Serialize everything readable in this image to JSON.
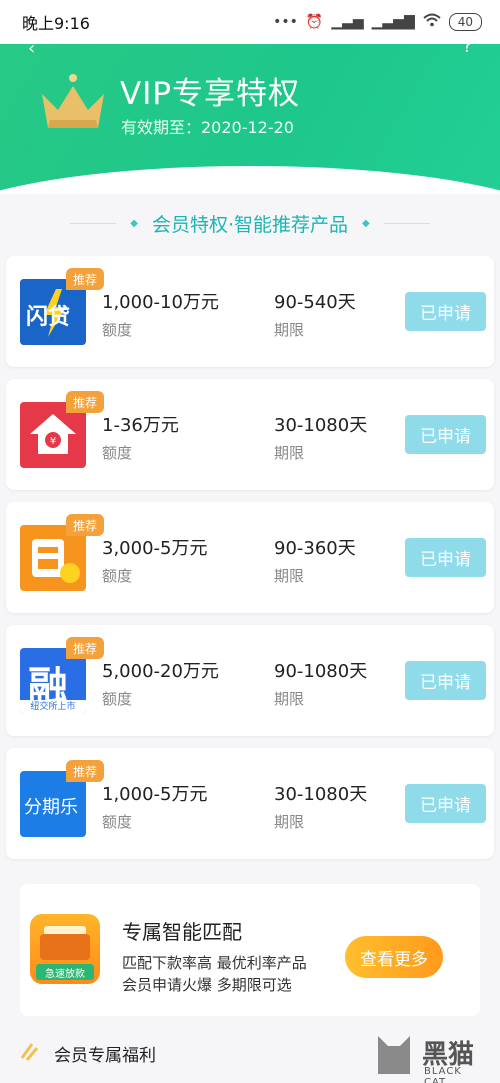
{
  "status_bar": {
    "time": "晚上9:16",
    "icons": [
      "more-dots-icon",
      "alarm-icon",
      "signal-x-icon",
      "hd-signal-icon",
      "wifi-icon"
    ],
    "battery": "40"
  },
  "header": {
    "title": "VIP专享特权",
    "expiry": "有效期至：2020-12-20",
    "crown_icon": "crown-icon",
    "gradient_colors": [
      "#27c985",
      "#22cf95"
    ]
  },
  "section": {
    "title": "会员特权·智能推荐产品"
  },
  "products": [
    {
      "tag": "推荐",
      "amount": "1,000-10万元",
      "amount_label": "额度",
      "term": "90-540天",
      "term_label": "期限",
      "button": "已申请",
      "logo_icon": "lightning-loan-logo-icon",
      "logo_text": "闪贷"
    },
    {
      "tag": "推荐",
      "amount": "1-36万元",
      "amount_label": "额度",
      "term": "30-1080天",
      "term_label": "期限",
      "button": "已申请",
      "logo_icon": "house-coin-logo-icon",
      "logo_text": ""
    },
    {
      "tag": "推荐",
      "amount": "3,000-5万元",
      "amount_label": "额度",
      "term": "90-360天",
      "term_label": "期限",
      "button": "已申请",
      "logo_icon": "orange-wallet-logo-icon",
      "logo_text": ""
    },
    {
      "tag": "推荐",
      "amount": "5,000-20万元",
      "amount_label": "额度",
      "term": "90-1080天",
      "term_label": "期限",
      "button": "已申请",
      "logo_icon": "rong-logo-icon",
      "logo_text": "融",
      "logo_subtext": "纽交所上市"
    },
    {
      "tag": "推荐",
      "amount": "1,000-5万元",
      "amount_label": "额度",
      "term": "30-1080天",
      "term_label": "期限",
      "button": "已申请",
      "logo_icon": "fenqile-logo-icon",
      "logo_text": "分期乐"
    }
  ],
  "promo": {
    "title": "专属智能匹配",
    "line1": "匹配下款率高 最优利率产品",
    "line2": "会员申请火爆 多期限可选",
    "button": "查看更多",
    "icon_label": "急速放款",
    "icon": "wallet-icon"
  },
  "benefits": {
    "title": "会员专属福利",
    "icon": "slash-stripes-icon"
  },
  "watermark": {
    "text": "黑猫",
    "subtext": "BLACK CAT"
  },
  "colors": {
    "accent_green": "#22c98a",
    "applied_button": "#8fdbe9",
    "tag_orange": "#f3a13a",
    "section_teal": "#1db4b4"
  }
}
